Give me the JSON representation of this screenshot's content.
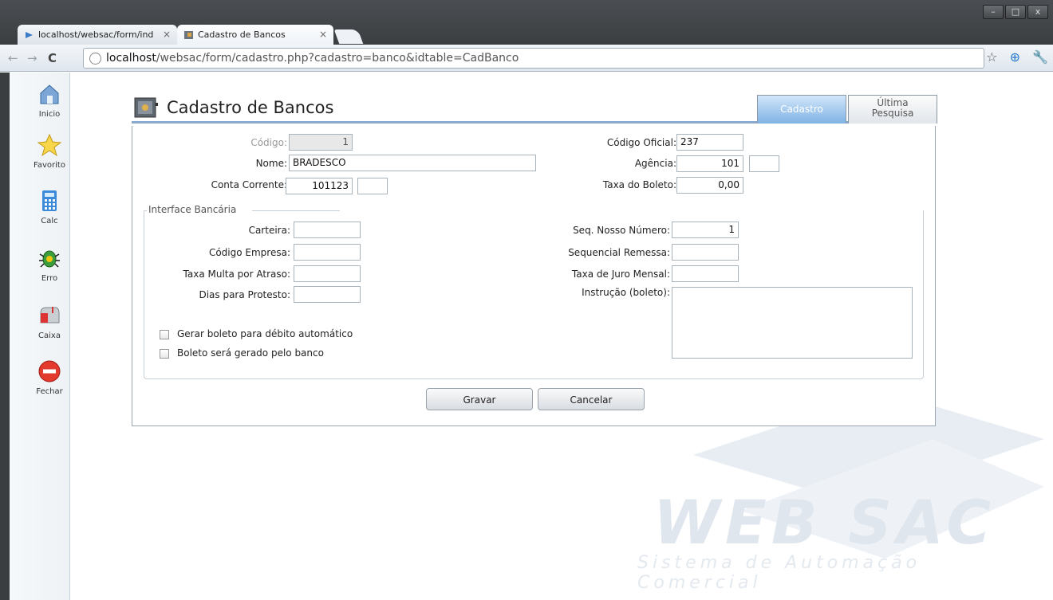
{
  "browser": {
    "tabs": [
      {
        "label": "localhost/websac/form/ind"
      },
      {
        "label": "Cadastro de Bancos"
      }
    ],
    "url_host": "localhost",
    "url_path": "/websac/form/cadastro.php?cadastro=banco&idtable=CadBanco"
  },
  "sidebar": {
    "items": [
      {
        "label": "Inicio",
        "icon": "home-icon"
      },
      {
        "label": "Favorito",
        "icon": "star-icon"
      },
      {
        "label": "Calc",
        "icon": "calculator-icon"
      },
      {
        "label": "Erro",
        "icon": "bug-icon"
      },
      {
        "label": "Caixa",
        "icon": "mailbox-icon"
      },
      {
        "label": "Fechar",
        "icon": "stop-icon"
      }
    ]
  },
  "form": {
    "title": "Cadastro de Bancos",
    "tabs": {
      "cadastro": "Cadastro",
      "ultima_line1": "Última",
      "ultima_line2": "Pesquisa"
    },
    "fields": {
      "codigo_label": "Código:",
      "codigo_value": "1",
      "nome_label": "Nome:",
      "nome_value": "BRADESCO",
      "conta_label": "Conta Corrente:",
      "conta_value": "101123",
      "conta_dv": "",
      "codigo_oficial_label": "Código Oficial:",
      "codigo_oficial_value": "237",
      "agencia_label": "Agência:",
      "agencia_value": "101",
      "agencia_dv": "",
      "taxa_boleto_label": "Taxa do Boleto:",
      "taxa_boleto_value": "0,00"
    },
    "interface": {
      "legend": "Interface Bancária",
      "carteira_label": "Carteira:",
      "carteira_value": "",
      "codigo_empresa_label": "Código Empresa:",
      "codigo_empresa_value": "",
      "taxa_multa_label": "Taxa Multa por Atraso:",
      "taxa_multa_value": "",
      "dias_protesto_label": "Dias para Protesto:",
      "dias_protesto_value": "",
      "seq_nosso_label": "Seq. Nosso Número:",
      "seq_nosso_value": "1",
      "seq_remessa_label": "Sequencial Remessa:",
      "seq_remessa_value": "",
      "taxa_juro_label": "Taxa de Juro Mensal:",
      "taxa_juro_value": "",
      "instrucao_label": "Instrução (boleto):",
      "instrucao_value": "",
      "chk_debito": "Gerar boleto para débito automático",
      "chk_banco": "Boleto será gerado pelo banco"
    },
    "buttons": {
      "gravar": "Gravar",
      "cancelar": "Cancelar"
    }
  },
  "watermark": {
    "brand": "WEB SAC",
    "tagline": "Sistema de Automação Comercial"
  },
  "colors": {
    "accent": "#7fb2e4",
    "header_line": "#8aa8cc",
    "chrome_frame": "#3b3e41"
  }
}
